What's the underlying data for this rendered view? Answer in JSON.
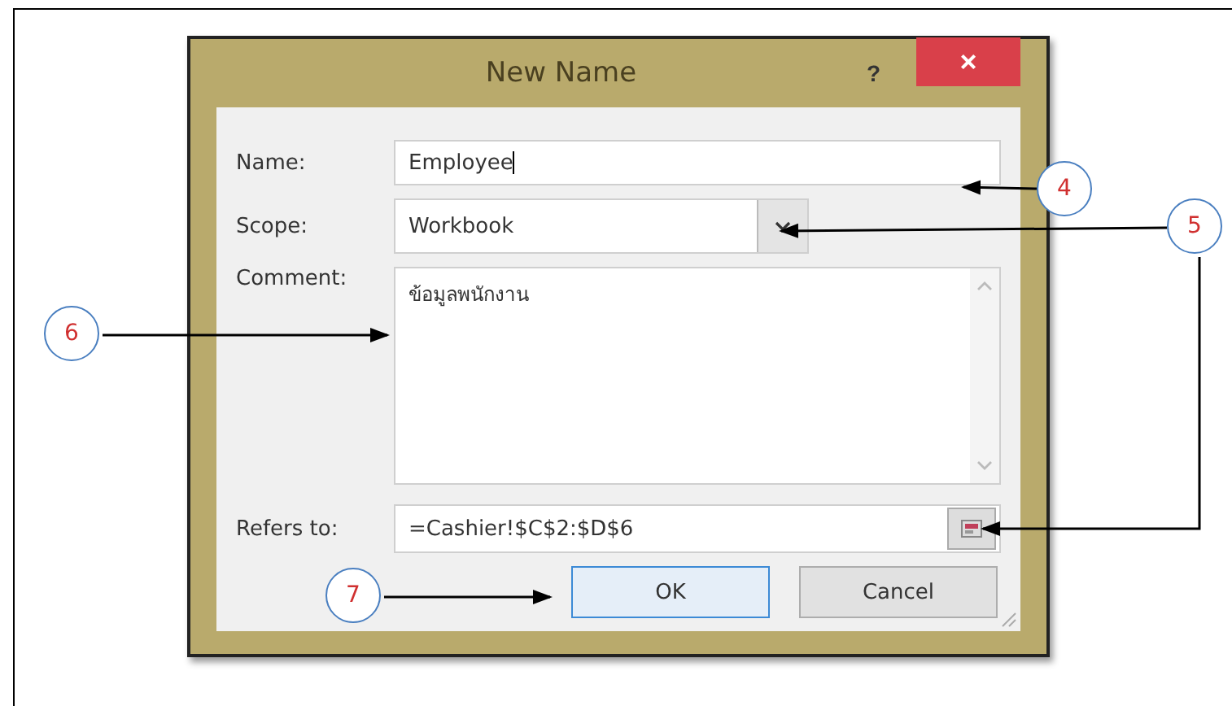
{
  "dialog": {
    "title": "New Name",
    "help": "?",
    "close": "×"
  },
  "name": {
    "label": "Name:",
    "value": "Employee"
  },
  "scope": {
    "label": "Scope:",
    "value": "Workbook"
  },
  "comment": {
    "label": "Comment:",
    "value": "ข้อมูลพนักงาน"
  },
  "refers_to": {
    "label": "Refers to:",
    "value": "=Cashier!$C$2:$D$6"
  },
  "buttons": [
    {
      "label": "OK",
      "selected": true
    },
    {
      "label": "Cancel",
      "selected": false
    }
  ],
  "callouts": [
    {
      "number": "4"
    },
    {
      "number": "5"
    },
    {
      "number": "6"
    },
    {
      "number": "7"
    }
  ]
}
